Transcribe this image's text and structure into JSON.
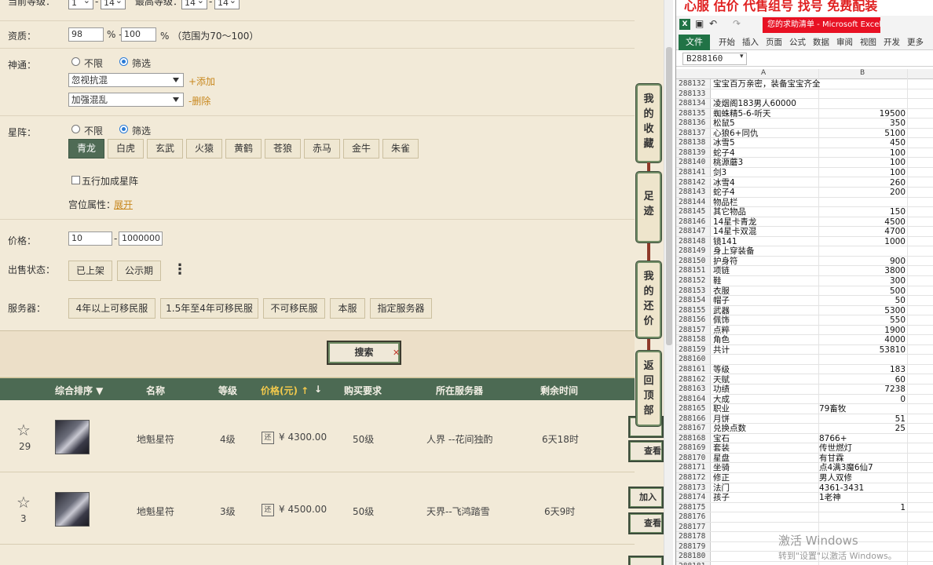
{
  "filters": {
    "level_label": "当前等级：",
    "level_min_a": "1",
    "level_min_b": "14",
    "level_max_label": "最高等级：",
    "level_max_a": "14",
    "level_max_b": "14",
    "aptitude_label": "资质：",
    "aptitude_min": "98",
    "aptitude_max": "100",
    "aptitude_pct_sep": "% -",
    "aptitude_hint": "%  （范围为70～100）",
    "shentong_label": "神通：",
    "opt_unlimited": "不限",
    "opt_filter": "筛选",
    "shentong_select1": "忽视抗混",
    "shentong_select2": "加强混乱",
    "add_link": "+添加",
    "delete_link": "-删除",
    "xingzhen_label": "星阵：",
    "xingzhen_chips": [
      "青龙",
      "白虎",
      "玄武",
      "火猿",
      "黄鹤",
      "苍狼",
      "赤马",
      "金牛",
      "朱雀"
    ],
    "wuxing_label": "五行加成星阵",
    "gongwei_label": "宫位属性：",
    "gongwei_link": "展开",
    "price_label": "价格：",
    "price_min": "10",
    "price_max": "1000000",
    "dash": "-",
    "sale_status_label": "出售状态：",
    "sale_listed": "已上架",
    "sale_public": "公示期",
    "more_dots": "⋮",
    "server_label": "服务器：",
    "server_options": [
      "4年以上可移民服",
      "1.5年至4年可移民服",
      "不可移民服",
      "本服",
      "指定服务器"
    ],
    "search_button": "搜索"
  },
  "table": {
    "headers": {
      "sort": "综合排序 ▼",
      "name": "名称",
      "level": "等级",
      "price": "价格(元) ↑",
      "price_arrow": "↓",
      "requirement": "购买要求",
      "server": "所在服务器",
      "remaining": "剩余时间"
    },
    "rows": [
      {
        "favorites": "29",
        "name": "地魁星符",
        "level": "4级",
        "huan": "还",
        "price": "¥ 4300.00",
        "requirement": "50级",
        "server": "人界 --花间独酌",
        "remaining": "6天18时"
      },
      {
        "favorites": "3",
        "name": "地魁星符",
        "level": "3级",
        "huan": "还",
        "price": "¥ 4500.00",
        "requirement": "50级",
        "server": "天界--飞鸿踏雪",
        "remaining": "6天9时"
      }
    ],
    "side_buttons": [
      "查看",
      "加入购",
      "查看"
    ]
  },
  "float_nav": {
    "favorites": "我的收藏",
    "footprint": "足迹",
    "bargain": "我的还价",
    "back_top": "返回顶部"
  },
  "excel": {
    "banner": "心服 估价 代售组号 找号 免费配装",
    "title": "您的求助清单 - Microsoft Excel(...",
    "file_tab": "文件",
    "ribbon_tabs": [
      "开始",
      "插入",
      "页面",
      "公式",
      "数据",
      "审阅",
      "视图",
      "开发",
      "更多"
    ],
    "name_box": "B288160",
    "col_a": "A",
    "col_b": "B",
    "rows": [
      {
        "r": "288132",
        "a": "宝宝百万亲密，装备宝宝齐全",
        "b": ""
      },
      {
        "r": "288133",
        "a": "",
        "b": ""
      },
      {
        "r": "288134",
        "a": "凌烟阁183男人60000",
        "b": ""
      },
      {
        "r": "288135",
        "a": "蜘蛛精5-6-听天",
        "b": "19500"
      },
      {
        "r": "288136",
        "a": "松鼠5",
        "b": "350"
      },
      {
        "r": "288137",
        "a": "心狼6+同仇",
        "b": "5100"
      },
      {
        "r": "288138",
        "a": "冰雪5",
        "b": "450"
      },
      {
        "r": "288139",
        "a": "蛇子4",
        "b": "100"
      },
      {
        "r": "288140",
        "a": "桃源蘑3",
        "b": "100"
      },
      {
        "r": "288141",
        "a": "剑3",
        "b": "100"
      },
      {
        "r": "288142",
        "a": "冰雪4",
        "b": "260"
      },
      {
        "r": "288143",
        "a": "蛇子4",
        "b": "200"
      },
      {
        "r": "288144",
        "a": "物品栏",
        "b": ""
      },
      {
        "r": "288145",
        "a": "其它物品",
        "b": "150"
      },
      {
        "r": "288146",
        "a": "14星卡青龙",
        "b": "4500"
      },
      {
        "r": "288147",
        "a": "14星卡双混",
        "b": "4700"
      },
      {
        "r": "288148",
        "a": "镜141",
        "b": "1000"
      },
      {
        "r": "288149",
        "a": "身上穿装备",
        "b": ""
      },
      {
        "r": "288150",
        "a": "护身符",
        "b": "900"
      },
      {
        "r": "288151",
        "a": "项链",
        "b": "3800"
      },
      {
        "r": "288152",
        "a": "鞋",
        "b": "300"
      },
      {
        "r": "288153",
        "a": "衣服",
        "b": "500"
      },
      {
        "r": "288154",
        "a": "帽子",
        "b": "50"
      },
      {
        "r": "288155",
        "a": "武器",
        "b": "5300"
      },
      {
        "r": "288156",
        "a": "佩饰",
        "b": "550"
      },
      {
        "r": "288157",
        "a": "点粹",
        "b": "1900"
      },
      {
        "r": "288158",
        "a": "角色",
        "b": "4000"
      },
      {
        "r": "288159",
        "a": "共计",
        "b": "53810"
      },
      {
        "r": "288160",
        "a": "",
        "b": ""
      },
      {
        "r": "288161",
        "a": "等级",
        "b": "183"
      },
      {
        "r": "288162",
        "a": "天赋",
        "b": "60"
      },
      {
        "r": "288163",
        "a": "功绩",
        "b": "7238"
      },
      {
        "r": "288164",
        "a": "大成",
        "b": "0"
      },
      {
        "r": "288165",
        "a": "职业",
        "b": "79畜牧"
      },
      {
        "r": "288166",
        "a": "月饼",
        "b": "51"
      },
      {
        "r": "288167",
        "a": "兑换点数",
        "b": "25"
      },
      {
        "r": "288168",
        "a": "宝石",
        "b": "8766+"
      },
      {
        "r": "288169",
        "a": "套装",
        "b": "传世燃灯"
      },
      {
        "r": "288170",
        "a": "星盘",
        "b": "有甘霖"
      },
      {
        "r": "288171",
        "a": "坐骑",
        "b": "点4满3魔6仙7"
      },
      {
        "r": "288172",
        "a": "修正",
        "b": "男人双修"
      },
      {
        "r": "288173",
        "a": "法门",
        "b": "4361-3431"
      },
      {
        "r": "288174",
        "a": "孩子",
        "b": "1老神"
      },
      {
        "r": "288175",
        "a": "",
        "b": "1"
      },
      {
        "r": "288176",
        "a": "",
        "b": ""
      },
      {
        "r": "288177",
        "a": "",
        "b": ""
      },
      {
        "r": "288178",
        "a": "",
        "b": ""
      },
      {
        "r": "288179",
        "a": "",
        "b": ""
      },
      {
        "r": "288180",
        "a": "",
        "b": ""
      },
      {
        "r": "288181",
        "a": "",
        "b": ""
      }
    ],
    "watermark": "激活 Windows",
    "watermark_sub": "转到\"设置\"以激活 Windows。"
  }
}
